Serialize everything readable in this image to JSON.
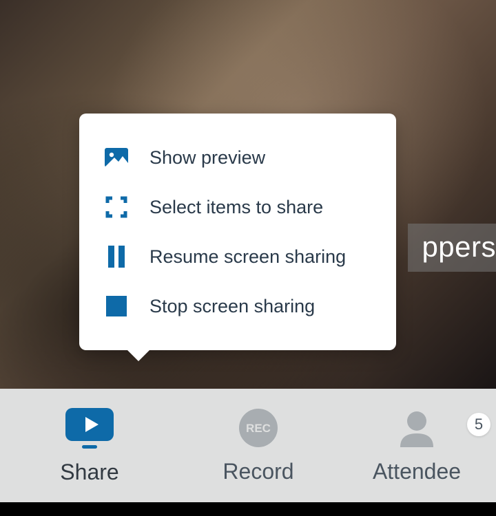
{
  "colors": {
    "accent": "#0e6aa8",
    "muted": "#a8adb1",
    "text": "#2a3a4a"
  },
  "video": {
    "name_fragment": "ppers"
  },
  "popup": {
    "items": [
      {
        "icon": "picture-icon",
        "label": "Show preview"
      },
      {
        "icon": "select-icon",
        "label": "Select items to share"
      },
      {
        "icon": "pause-icon",
        "label": "Resume screen sharing"
      },
      {
        "icon": "stop-icon",
        "label": "Stop screen sharing"
      }
    ]
  },
  "toolbar": {
    "share": {
      "label": "Share"
    },
    "record": {
      "label": "Record",
      "icon_text": "REC"
    },
    "attendees": {
      "label": "Attendee",
      "badge": "5"
    }
  }
}
